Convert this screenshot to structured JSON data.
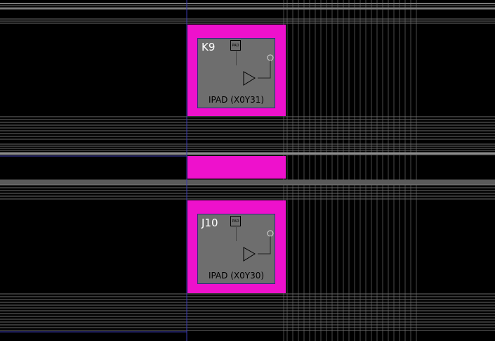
{
  "pads": [
    {
      "name": "K9",
      "site": "IPAD (X0Y31)",
      "symbol": "PAD"
    },
    {
      "name": "J10",
      "site": "IPAD (X0Y30)",
      "symbol": "PAD"
    }
  ],
  "colors": {
    "background": "#000000",
    "tile": "#ee11cc",
    "pad_fill": "#6e6e6e",
    "wire": "#6a6a6a",
    "selection_line": "#3a3ab0"
  }
}
